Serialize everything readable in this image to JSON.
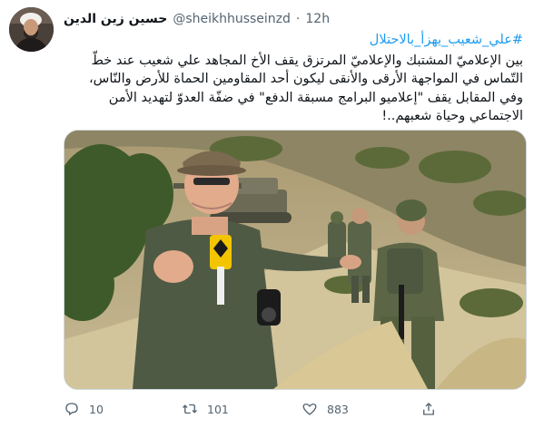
{
  "tweet": {
    "author": {
      "display_name": "حسين زين الدين",
      "handle": "@sheikhhusseinzd",
      "separator": "·",
      "time": "12h"
    },
    "hashtag": "#علي_شعيب_يهزأ_بالاحتلال",
    "paragraphs": [
      "بين الإعلاميّ المشتبك والإعلاميّ المرتزق يقف الأخ المجاهد علي شعيب عند خطّ التّماس في المواجهة الأرقى والأنقى ليكون أحد المقاومين الحماة للأرض والنّاس،",
      "وفي المقابل يقف \"إعلاميو البرامج مسبقة الدفع\" في ضفّة العدوّ لتهديد الأمن الاجتماعي وحياة شعبهم..!"
    ],
    "media": {
      "icons": [
        "microphone-icon",
        "camera-icon"
      ]
    },
    "actions": {
      "reply_count": "10",
      "retweet_count": "101",
      "like_count": "883",
      "icons": [
        "reply-icon",
        "retweet-icon",
        "like-icon",
        "share-icon"
      ]
    }
  },
  "colors": {
    "hashtag": "#1d9bf0",
    "secondary_text": "#536471",
    "primary_text": "#0f1419",
    "border": "#cfd9de"
  }
}
